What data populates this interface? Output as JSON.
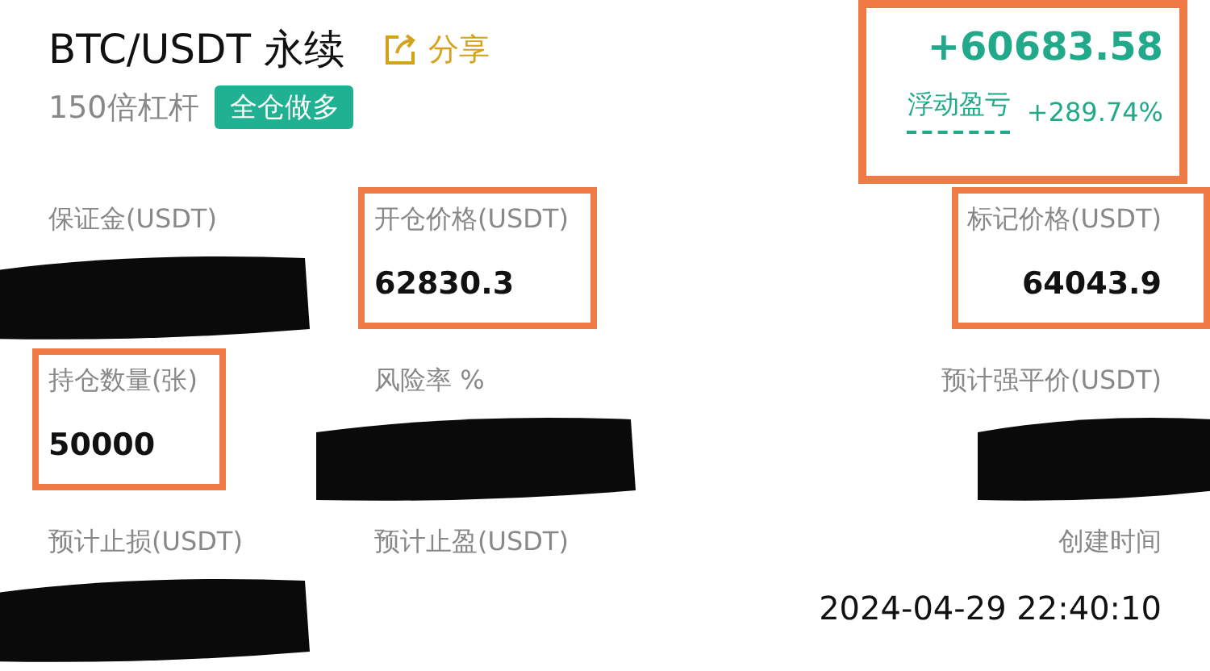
{
  "header": {
    "title": "BTC/USDT 永续",
    "share": "分享",
    "leverage": "150倍杠杆",
    "mode_tag": "全仓做多"
  },
  "pnl": {
    "highlighted": true,
    "amount": "+60683.58",
    "label": "浮动盈亏",
    "percent": "+289.74%"
  },
  "fields": [
    {
      "label": "保证金(USDT)",
      "redacted": true
    },
    {
      "label": "开仓价格(USDT)",
      "value": "62830.3",
      "highlighted": true
    },
    {
      "label": "标记价格(USDT)",
      "value": "64043.9",
      "highlighted": true
    },
    {
      "label": "持仓数量(张)",
      "value": "50000",
      "highlighted": true
    },
    {
      "label": "风险率 %",
      "redacted": true
    },
    {
      "label": "预计强平价(USDT)",
      "redacted": true
    },
    {
      "label": "预计止损(USDT)",
      "redacted": true
    },
    {
      "label": "预计止盈(USDT)"
    },
    {
      "label": "创建时间",
      "value": "2024-04-29 22:40:10"
    }
  ]
}
